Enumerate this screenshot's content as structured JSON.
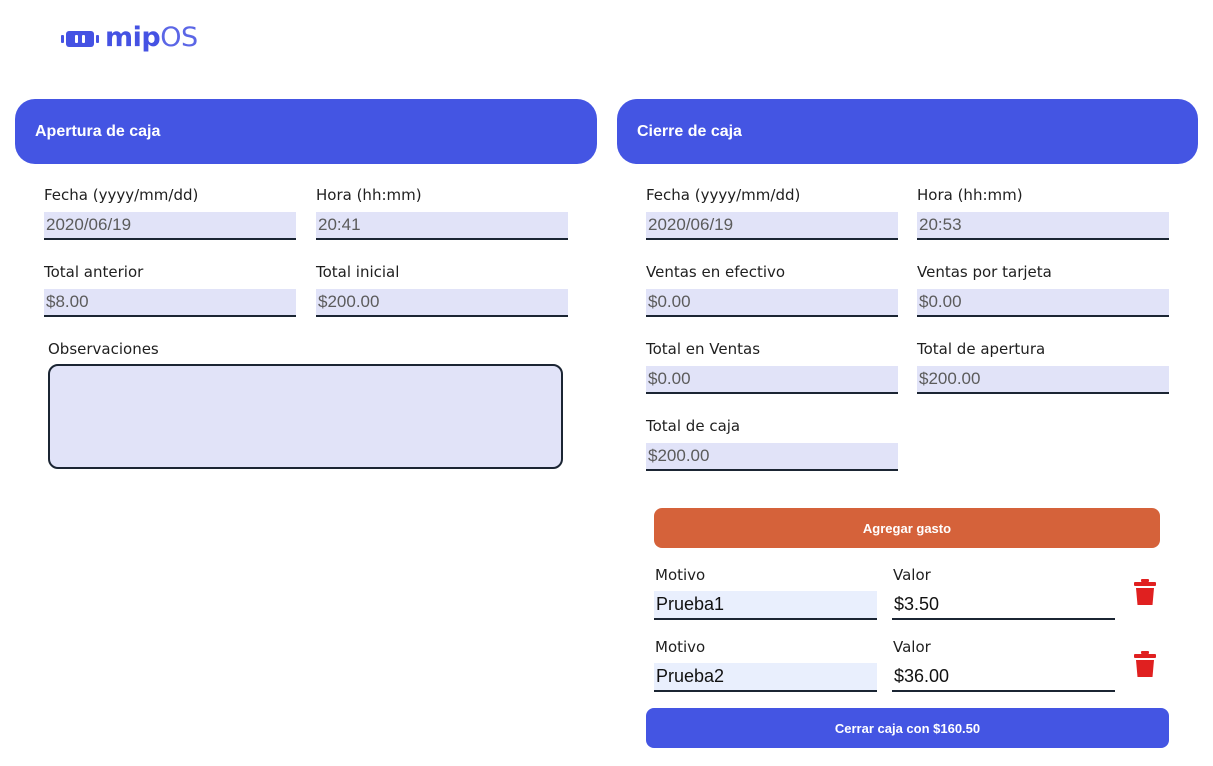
{
  "brand": {
    "bold": "mip",
    "light": "OS",
    "accent": "#4455e3"
  },
  "apertura": {
    "title": "Apertura de caja",
    "fecha_label": "Fecha (yyyy/mm/dd)",
    "fecha_value": "2020/06/19",
    "hora_label": "Hora (hh:mm)",
    "hora_value": "20:41",
    "total_anterior_label": "Total anterior",
    "total_anterior_value": "$8.00",
    "total_inicial_label": "Total inicial",
    "total_inicial_value": "$200.00",
    "observaciones_label": "Observaciones",
    "observaciones_value": ""
  },
  "cierre": {
    "title": "Cierre de caja",
    "fecha_label": "Fecha (yyyy/mm/dd)",
    "fecha_value": "2020/06/19",
    "hora_label": "Hora (hh:mm)",
    "hora_value": "20:53",
    "ventas_efectivo_label": "Ventas en efectivo",
    "ventas_efectivo_value": "$0.00",
    "ventas_tarjeta_label": "Ventas por tarjeta",
    "ventas_tarjeta_value": "$0.00",
    "total_ventas_label": "Total en Ventas",
    "total_ventas_value": "$0.00",
    "total_apertura_label": "Total de apertura",
    "total_apertura_value": "$200.00",
    "total_caja_label": "Total de caja",
    "total_caja_value": "$200.00",
    "agregar_gasto_label": "Agregar gasto",
    "cerrar_caja_label": "Cerrar caja con $160.50",
    "gastos": [
      {
        "motivo_label": "Motivo",
        "motivo_value": "Prueba1",
        "valor_label": "Valor",
        "valor_value": "$3.50",
        "delete_icon": "trash-icon"
      },
      {
        "motivo_label": "Motivo",
        "motivo_value": "Prueba2",
        "valor_label": "Valor",
        "valor_value": "$36.00",
        "delete_icon": "trash-icon"
      }
    ]
  },
  "colors": {
    "header": "#4455e3",
    "orange_button": "#d5623a",
    "input_bg": "#e1e3f8",
    "trash": "#e02020"
  }
}
